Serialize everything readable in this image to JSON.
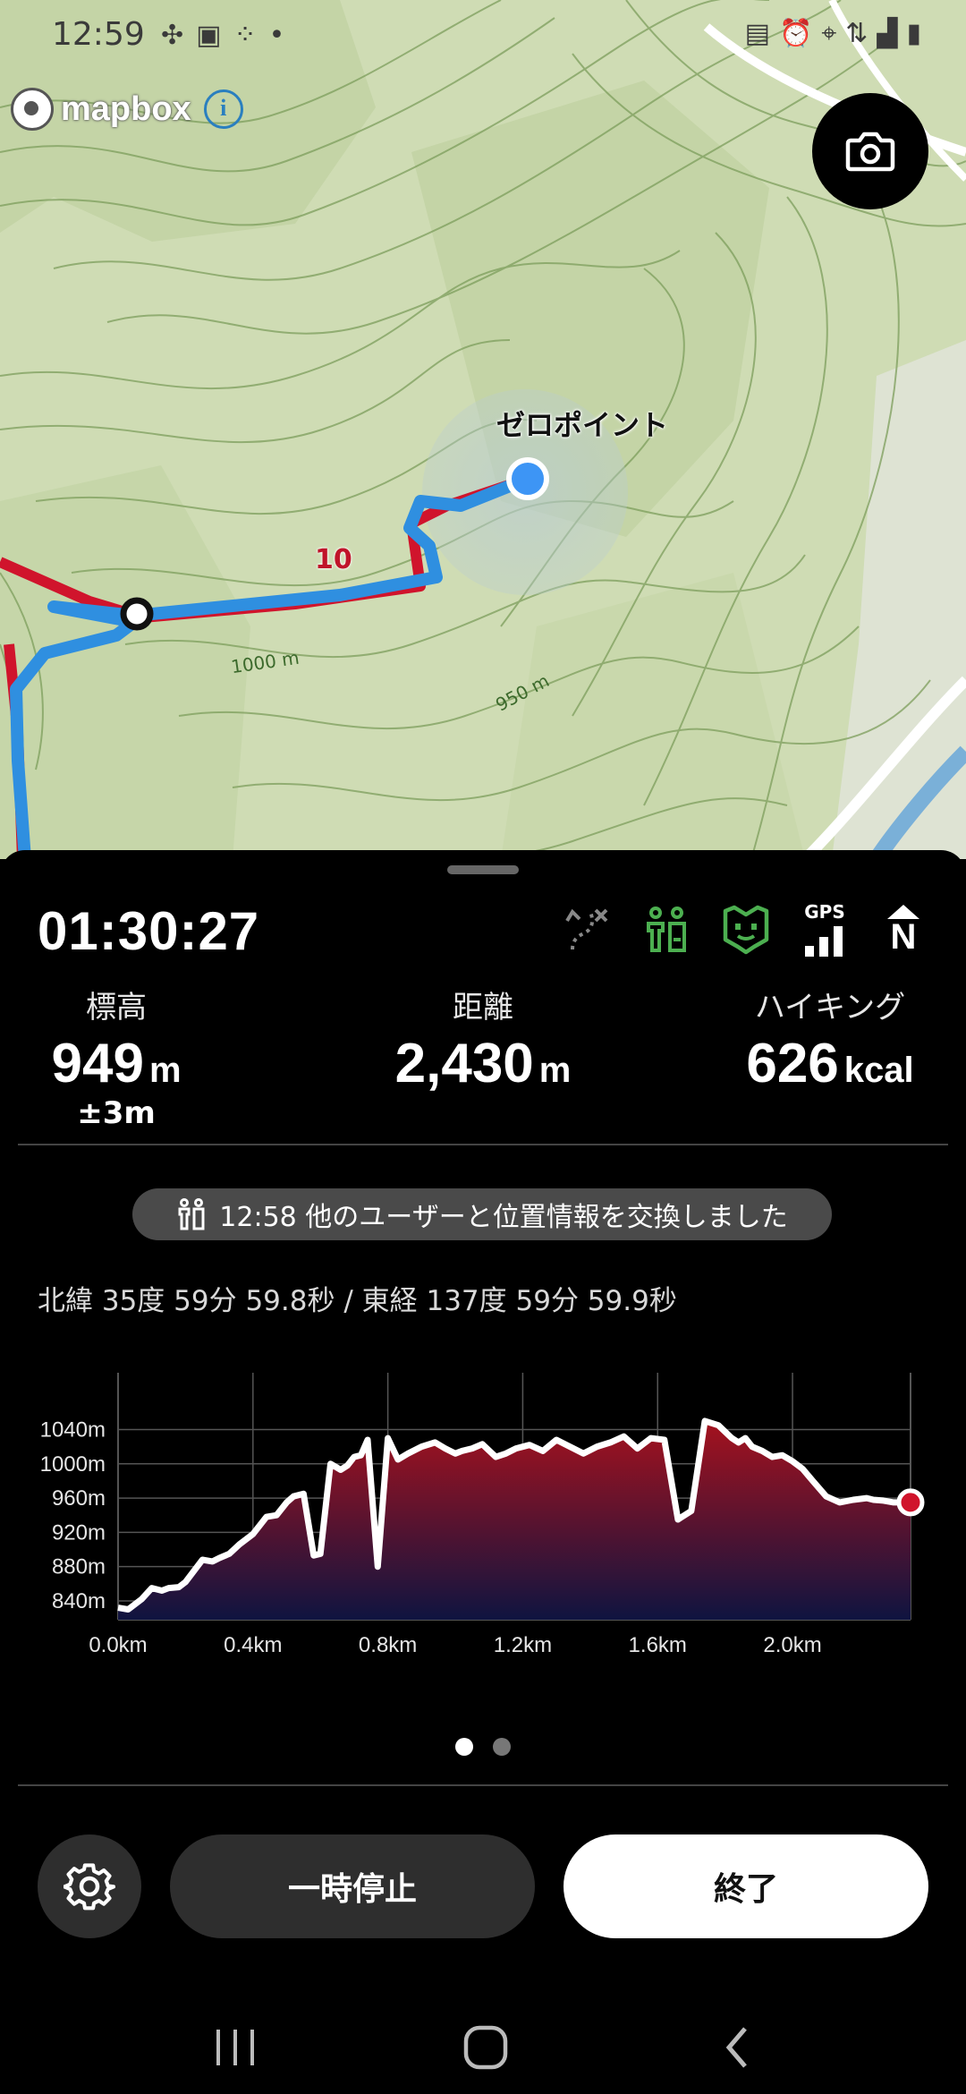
{
  "status_bar": {
    "time": "12:59",
    "left_icons": [
      "fan-icon",
      "image-icon",
      "grid-icon",
      "dot-icon"
    ],
    "right_icons": [
      "nfc-icon",
      "alarm-icon",
      "location-icon",
      "4g-icon",
      "signal-icon",
      "battery-icon"
    ]
  },
  "map": {
    "attribution": "mapbox",
    "info_glyph": "i",
    "point_label": "ゼロポイント",
    "route_number": "10",
    "contour_labels": [
      "1000 m",
      "950 m"
    ],
    "colors": {
      "terrain": "#cfdcb4",
      "route_blue": "#2f8fe0",
      "route_red": "#d0142c",
      "location": "#3d95f5"
    }
  },
  "panel": {
    "timer": "01:30:27",
    "status_icons": [
      "route-off-icon",
      "other-users-icon",
      "companion-icon",
      "gps-signal-icon",
      "north-up-icon"
    ],
    "gps_label": "GPS",
    "north_label": "N",
    "stats": {
      "altitude": {
        "label": "標高",
        "value": "949",
        "unit": "m",
        "accuracy": "±3m"
      },
      "distance": {
        "label": "距離",
        "value": "2,430",
        "unit": "m"
      },
      "calories": {
        "label": "ハイキング",
        "value": "626",
        "unit": "kcal"
      }
    },
    "toast": "12:58 他のユーザーと位置情報を交換しました",
    "coordinates": "北緯 35度 59分 59.8秒 / 東経 137度 59分 59.9秒",
    "page_dots": 2,
    "active_dot": 0,
    "buttons": {
      "pause": "一時停止",
      "end": "終了"
    }
  },
  "chart_data": {
    "type": "area",
    "title": "",
    "xlabel": "",
    "ylabel": "",
    "x_ticks": [
      "0.0km",
      "0.4km",
      "0.8km",
      "1.2km",
      "1.6km",
      "2.0km"
    ],
    "y_ticks": [
      "840m",
      "880m",
      "920m",
      "960m",
      "1000m",
      "1040m"
    ],
    "xlim": [
      0,
      2.35
    ],
    "ylim": [
      818,
      1075
    ],
    "grid": true,
    "series": [
      {
        "x": [
          0,
          0.03,
          0.07,
          0.1,
          0.13,
          0.15,
          0.18,
          0.2,
          0.25,
          0.28,
          0.3,
          0.33,
          0.36,
          0.4,
          0.44,
          0.47,
          0.5,
          0.52,
          0.55,
          0.58,
          0.6,
          0.63,
          0.66,
          0.68,
          0.7,
          0.72,
          0.74,
          0.77,
          0.8,
          0.83,
          0.86,
          0.9,
          0.94,
          0.97,
          1.0,
          1.02,
          1.05,
          1.08,
          1.12,
          1.15,
          1.18,
          1.22,
          1.26,
          1.3,
          1.34,
          1.38,
          1.42,
          1.46,
          1.5,
          1.54,
          1.58,
          1.62,
          1.66,
          1.7,
          1.74,
          1.78,
          1.82,
          1.84,
          1.86,
          1.88,
          1.91,
          1.94,
          1.97,
          2.0,
          2.03,
          2.06,
          2.1,
          2.14,
          2.18,
          2.22,
          2.24,
          2.27,
          2.3,
          2.35
        ],
        "y": [
          832,
          830,
          842,
          855,
          852,
          855,
          856,
          862,
          888,
          886,
          890,
          895,
          906,
          918,
          938,
          940,
          955,
          962,
          965,
          893,
          895,
          1000,
          993,
          998,
          1008,
          1010,
          1028,
          880,
          1030,
          1005,
          1012,
          1020,
          1025,
          1018,
          1012,
          1015,
          1018,
          1023,
          1008,
          1012,
          1018,
          1022,
          1015,
          1028,
          1020,
          1012,
          1020,
          1025,
          1032,
          1018,
          1030,
          1028,
          935,
          945,
          1050,
          1045,
          1030,
          1025,
          1030,
          1020,
          1015,
          1008,
          1010,
          1003,
          994,
          980,
          962,
          955,
          958,
          960,
          958,
          957,
          955,
          955
        ]
      }
    ],
    "end_point": {
      "x": 2.35,
      "y": 955
    },
    "colors": {
      "line": "#ffffff",
      "fill_top": "#a5121e",
      "fill_bottom": "#0f1440",
      "end_marker": "#d0142c",
      "grid": "#555555"
    }
  }
}
